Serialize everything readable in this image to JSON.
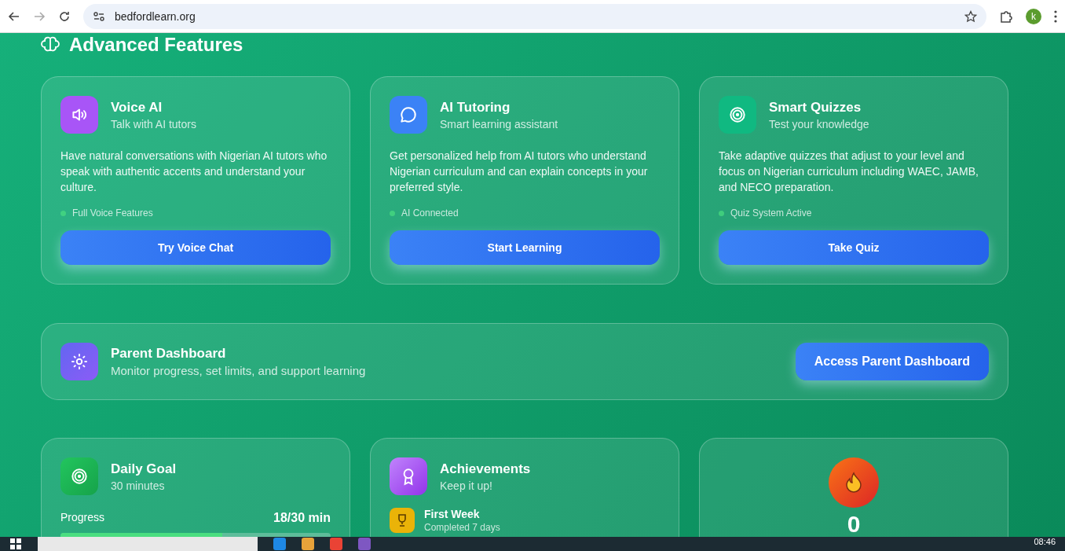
{
  "browser": {
    "url": "bedfordlearn.org",
    "profile_initial": "k"
  },
  "section_title": "Advanced Features",
  "features": [
    {
      "kind": "speaker",
      "color": "#a855f7",
      "title": "Voice AI",
      "subtitle": "Talk with AI tutors",
      "description": "Have natural conversations with Nigerian AI tutors who speak with authentic accents and understand your culture.",
      "status": "Full Voice Features",
      "button": "Try Voice Chat"
    },
    {
      "kind": "chat",
      "color": "#3b82f6",
      "title": "AI Tutoring",
      "subtitle": "Smart learning assistant",
      "description": "Get personalized help from AI tutors who understand Nigerian curriculum and can explain concepts in your preferred style.",
      "status": "AI Connected",
      "button": "Start Learning"
    },
    {
      "kind": "target",
      "color": "#10b981",
      "title": "Smart Quizzes",
      "subtitle": "Test your knowledge",
      "description": "Take adaptive quizzes that adjust to your level and focus on Nigerian curriculum including WAEC, JAMB, and NECO preparation.",
      "status": "Quiz System Active",
      "button": "Take Quiz"
    }
  ],
  "parent_dashboard": {
    "title": "Parent Dashboard",
    "subtitle": "Monitor progress, set limits, and support learning",
    "button": "Access Parent Dashboard"
  },
  "daily_goal": {
    "title": "Daily Goal",
    "subtitle": "30 minutes",
    "progress_label": "Progress",
    "progress_value": "18/30 min",
    "level": 0.6
  },
  "achievements": {
    "title": "Achievements",
    "subtitle": "Keep it up!",
    "items": [
      {
        "title": "First Week",
        "detail": "Completed 7 days"
      }
    ]
  },
  "streak": {
    "count": "0"
  },
  "taskbar": {
    "time": "08:46"
  }
}
